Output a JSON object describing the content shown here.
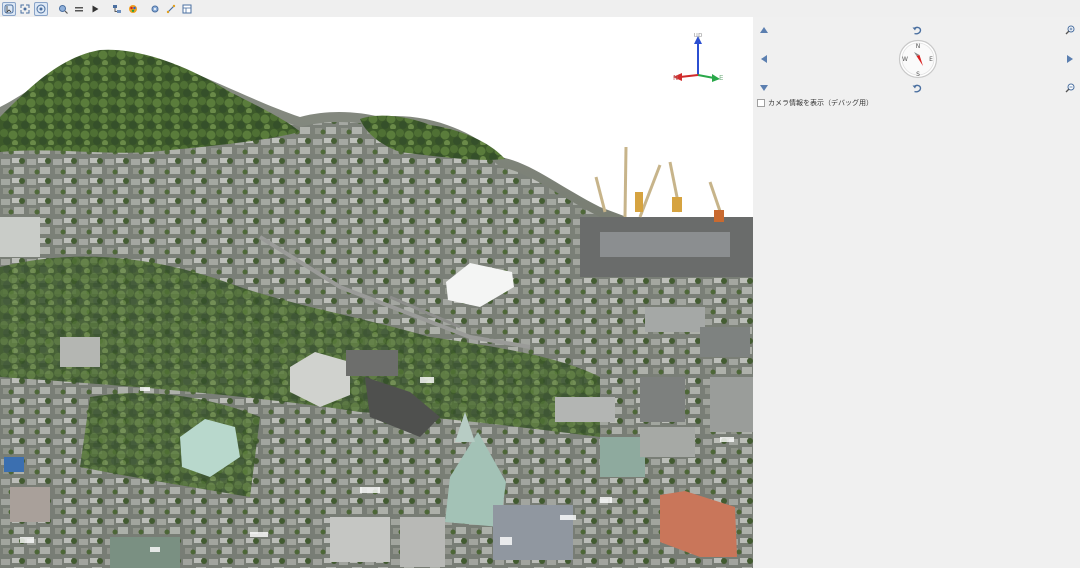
{
  "toolbar": {
    "tools": [
      {
        "name": "select-tool-icon",
        "active": true
      },
      {
        "name": "fit-view-icon",
        "active": false
      },
      {
        "name": "orbit-tool-icon",
        "active": true
      },
      {
        "name": "zoom-tool-icon",
        "active": false
      },
      {
        "name": "layers-tool-icon",
        "active": false
      },
      {
        "name": "play-icon",
        "active": false
      },
      {
        "name": "tree-tool-icon",
        "active": false
      },
      {
        "name": "color-tool-icon",
        "active": false
      },
      {
        "name": "point-tool-icon",
        "active": false
      },
      {
        "name": "measure-tool-icon",
        "active": false
      },
      {
        "name": "table-tool-icon",
        "active": false
      }
    ]
  },
  "viewport": {
    "axis": {
      "up": "up",
      "east": "E",
      "north": "N"
    },
    "scene": "3D point cloud aerial view of hillside city with harbor cranes"
  },
  "panel": {
    "compass": {
      "n": "N",
      "s": "S",
      "e": "E",
      "w": "W"
    },
    "debug_checkbox": {
      "label": "カメラ情報を表示（デバッグ用）",
      "checked": false
    }
  },
  "colors": {
    "accent": "#5b7fb0",
    "axis_up": "#2b4fd1",
    "axis_east": "#2aa84a",
    "axis_north": "#d12b2b",
    "compass_needle": "#d92020"
  }
}
